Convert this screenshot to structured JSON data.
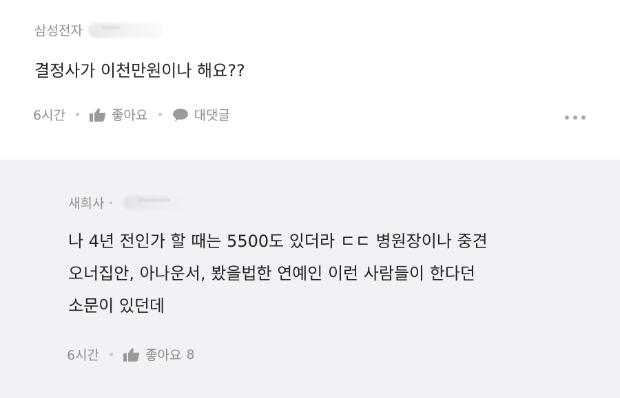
{
  "comments": [
    {
      "author": "삼성전자",
      "nickname_masked": "·····",
      "text": "결정사가 이천만원이나 해요??",
      "time": "6시간",
      "like_label": "좋아요",
      "reply_label": "대댓글"
    }
  ],
  "reply": {
    "author": "새희사",
    "nickname_masked": "·········",
    "text": "나 4년 전인가 할 때는 5500도 있더라 ㄷㄷ 병원장이나 중견\n오너집안, 아나운서, 봤을법한 연예인 이런 사람들이 한다던\n소문이 있던데",
    "time": "6시간",
    "like_label": "좋아요",
    "like_count": "8"
  },
  "colors": {
    "reply_bg": "#f1f2f6",
    "meta": "#8e8e8e",
    "text": "#222222"
  },
  "icons": {
    "like": "thumbs-up-icon",
    "reply": "speech-bubble-icon",
    "more": "more-dots-icon"
  }
}
